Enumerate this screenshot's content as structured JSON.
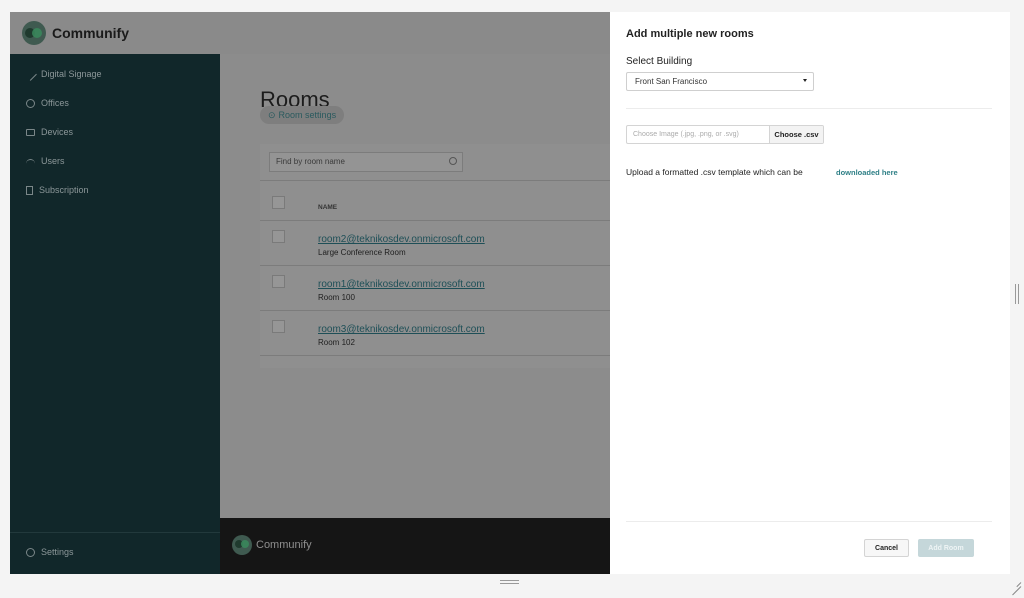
{
  "app": {
    "name": "Communify"
  },
  "sidebar": {
    "items": [
      {
        "label": "Digital Signage",
        "icon": "pencil-icon"
      },
      {
        "label": "Offices",
        "icon": "gear-icon"
      },
      {
        "label": "Devices",
        "icon": "monitor-icon"
      },
      {
        "label": "Users",
        "icon": "user-icon"
      },
      {
        "label": "Subscription",
        "icon": "document-icon"
      }
    ],
    "settings_label": "Settings"
  },
  "main": {
    "title": "Rooms",
    "room_settings_label": "Room settings",
    "search_placeholder": "Find by room name",
    "table": {
      "column_name": "NAME",
      "rows": [
        {
          "email": "room2@teknikosdev.onmicrosoft.com",
          "name": "Large Conference Room"
        },
        {
          "email": "room1@teknikosdev.onmicrosoft.com",
          "name": "Room 100"
        },
        {
          "email": "room3@teknikosdev.onmicrosoft.com",
          "name": "Room 102"
        }
      ]
    }
  },
  "footer": {
    "brand": "Communify"
  },
  "modal": {
    "title": "Add multiple new rooms",
    "building_label": "Select Building",
    "building_value": "Front San Francisco",
    "file_placeholder": "Choose Image (.jpg, .png, or .svg)",
    "choose_button": "Choose .csv",
    "upload_text": "Upload a formatted .csv template which can be",
    "upload_link": "downloaded here",
    "cancel_button": "Cancel",
    "add_button": "Add Room"
  },
  "colors": {
    "sidebar_bg": "#11272a",
    "link_teal": "#2e7f86",
    "add_button_disabled": "#c5d7da"
  }
}
